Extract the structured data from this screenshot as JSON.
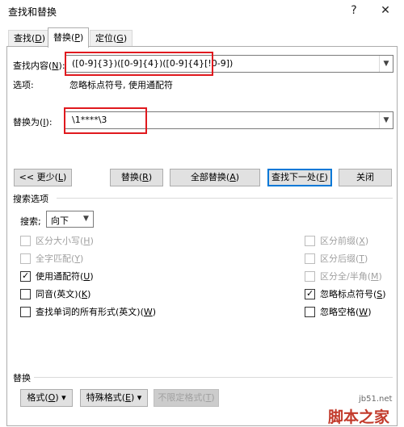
{
  "window": {
    "title": "查找和替换",
    "help": "?",
    "close": "✕"
  },
  "tabs": [
    {
      "label": "查找(",
      "key": "D",
      "suffix": ")"
    },
    {
      "label": "替换(",
      "key": "P",
      "suffix": ")"
    },
    {
      "label": "定位(",
      "key": "G",
      "suffix": ")"
    }
  ],
  "find": {
    "label": "查找内容(",
    "key": "N",
    "suffix": "):",
    "value": "([0-9]{3})([0-9]{4})([0-9]{4}[!0-9])",
    "options_label": "选项:",
    "options_value": "忽略标点符号, 使用通配符"
  },
  "replace": {
    "label": "替换为(",
    "key": "I",
    "suffix": "):",
    "value": "\\1****\\3"
  },
  "buttons": {
    "less": {
      "label": "<< 更少(",
      "key": "L",
      "suffix": ")"
    },
    "replace": {
      "label": "替换(",
      "key": "R",
      "suffix": ")"
    },
    "replace_all": {
      "label": "全部替换(",
      "key": "A",
      "suffix": ")"
    },
    "find_next": {
      "label": "查找下一处(",
      "key": "F",
      "suffix": ")"
    },
    "close": {
      "label": "关闭"
    }
  },
  "search_options": {
    "section_title": "搜索选项",
    "search_label": "搜索;",
    "search_value": "向下",
    "left": [
      {
        "label": "区分大小写(",
        "key": "H",
        "suffix": ")",
        "checked": false,
        "disabled": true
      },
      {
        "label": "全字匹配(",
        "key": "Y",
        "suffix": ")",
        "checked": false,
        "disabled": true
      },
      {
        "label": "使用通配符(",
        "key": "U",
        "suffix": ")",
        "checked": true,
        "disabled": false
      },
      {
        "label": "同音(英文)(",
        "key": "K",
        "suffix": ")",
        "checked": false,
        "disabled": false
      },
      {
        "label": "查找单词的所有形式(英文)(",
        "key": "W",
        "suffix": ")",
        "checked": false,
        "disabled": false
      }
    ],
    "right": [
      {
        "label": "区分前缀(",
        "key": "X",
        "suffix": ")",
        "checked": false,
        "disabled": true
      },
      {
        "label": "区分后缀(",
        "key": "T",
        "suffix": ")",
        "checked": false,
        "disabled": true
      },
      {
        "label": "区分全/半角(",
        "key": "M",
        "suffix": ")",
        "checked": false,
        "disabled": true
      },
      {
        "label": "忽略标点符号(",
        "key": "S",
        "suffix": ")",
        "checked": true,
        "disabled": false
      },
      {
        "label": "忽略空格(",
        "key": "W",
        "suffix": ")",
        "checked": false,
        "disabled": false
      }
    ]
  },
  "replace_section": {
    "title": "替换",
    "format": {
      "label": "格式(",
      "key": "O",
      "suffix": ") ▾"
    },
    "special": {
      "label": "特殊格式(",
      "key": "E",
      "suffix": ") ▾"
    },
    "no_format": {
      "label": "不限定格式(",
      "key": "T",
      "suffix": ")"
    }
  },
  "watermark": {
    "line1": "jb51.net",
    "line2": "脚本之家"
  },
  "colors": {
    "highlight_box": "#e0191e",
    "default_button_border": "#0078d7"
  }
}
